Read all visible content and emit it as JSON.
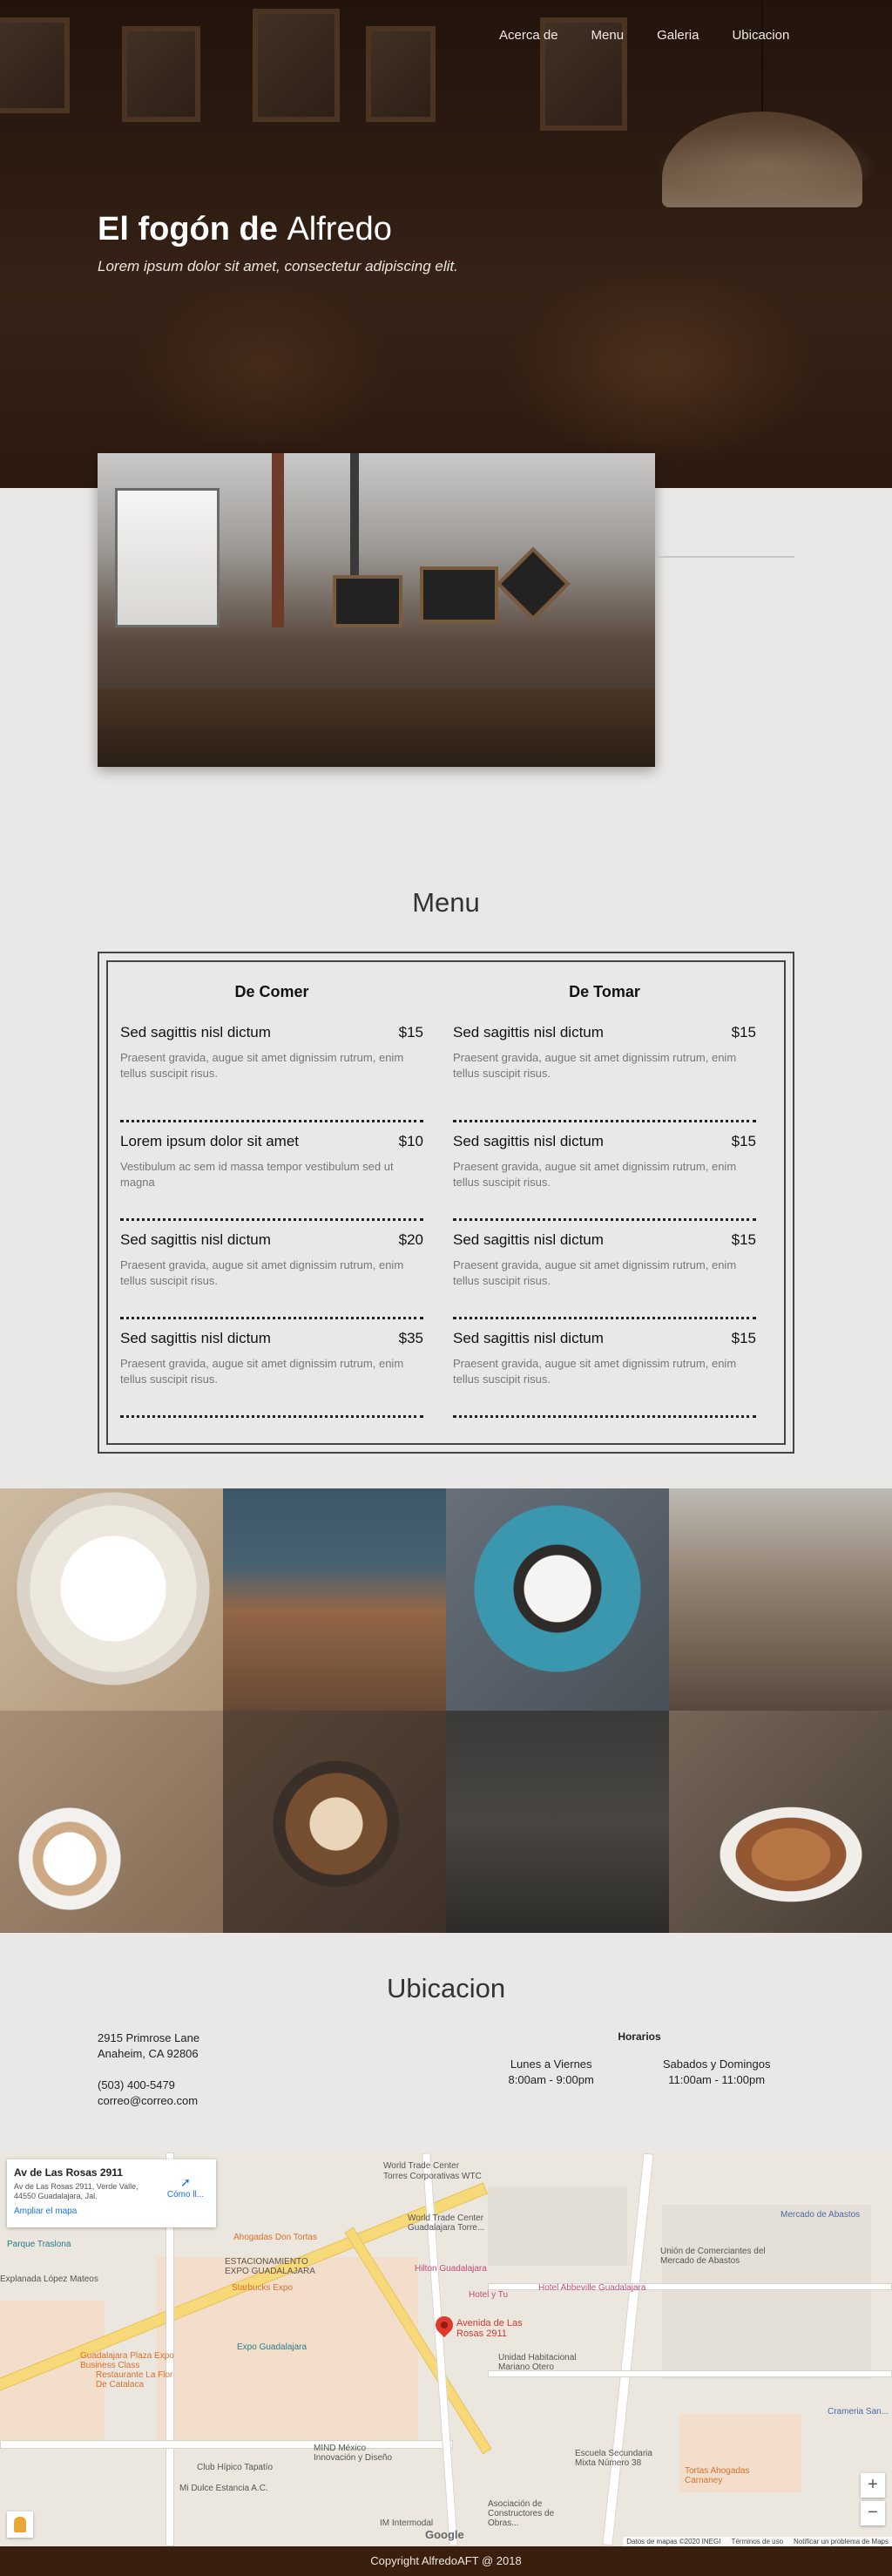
{
  "nav": {
    "items": [
      "Acerca de",
      "Menu",
      "Galeria",
      "Ubicacion"
    ]
  },
  "hero": {
    "title_bold": "El fogón de",
    "title_light": "Alfredo",
    "subtitle": "Lorem ipsum dolor sit amet, consectetur adipiscing elit."
  },
  "menu": {
    "title": "Menu",
    "columns": [
      {
        "heading": "De Comer",
        "items": [
          {
            "name": "Sed sagittis nisl dictum",
            "price": "$15",
            "desc": "Praesent gravida, augue sit amet dignissim rutrum, enim tellus suscipit risus."
          },
          {
            "name": "Lorem ipsum dolor sit amet",
            "price": "$10",
            "desc": "Vestibulum ac sem id massa tempor vestibulum sed ut magna"
          },
          {
            "name": "Sed sagittis nisl dictum",
            "price": "$20",
            "desc": "Praesent gravida, augue sit amet dignissim rutrum, enim tellus suscipit risus."
          },
          {
            "name": "Sed sagittis nisl dictum",
            "price": "$35",
            "desc": "Praesent gravida, augue sit amet dignissim rutrum, enim tellus suscipit risus."
          }
        ]
      },
      {
        "heading": "De Tomar",
        "items": [
          {
            "name": "Sed sagittis nisl dictum",
            "price": "$15",
            "desc": "Praesent gravida, augue sit amet dignissim rutrum, enim tellus suscipit risus."
          },
          {
            "name": "Sed sagittis nisl dictum",
            "price": "$15",
            "desc": "Praesent gravida, augue sit amet dignissim rutrum, enim tellus suscipit risus."
          },
          {
            "name": "Sed sagittis nisl dictum",
            "price": "$15",
            "desc": "Praesent gravida, augue sit amet dignissim rutrum, enim tellus suscipit risus."
          },
          {
            "name": "Sed sagittis nisl dictum",
            "price": "$15",
            "desc": "Praesent gravida, augue sit amet dignissim rutrum, enim tellus suscipit risus."
          }
        ]
      }
    ]
  },
  "location": {
    "title": "Ubicacion",
    "address_line1": "2915 Primrose Lane",
    "address_line2": "Anaheim, CA 92806",
    "phone": "(503) 400-5479",
    "email": "correo@correo.com",
    "hours_title": "Horarios",
    "hours": [
      {
        "days": "Lunes a Viernes",
        "time": "8:00am - 9:00pm"
      },
      {
        "days": "Sabados y Domingos",
        "time": "11:00am - 11:00pm"
      }
    ]
  },
  "map": {
    "card_title": "Av de Las Rosas 2911",
    "card_address": "Av de Las Rosas 2911, Verde Valle, 44550 Guadalajara, Jal.",
    "card_link": "Ampliar el mapa",
    "card_directions": "Cómo ll...",
    "pin_label_1": "Avenida de Las",
    "pin_label_2": "Rosas 2911",
    "labels": [
      "World Trade Center",
      "Torres Corporativas WTC",
      "World Trade Center Guadalajara Torre...",
      "Parque Traslona",
      "Explanada López Mateos",
      "Ahogadas Don Tortas",
      "ESTACIONAMIENTO EXPO GUADALAJARA",
      "Starbucks Expo",
      "Hilton Guadalajara",
      "Hotel y Tu",
      "Hotel Abbeville Guadalajara",
      "Expo Guadalajara",
      "Unidad Habitacional Mariano Otero",
      "Unión de Comerciantes del Mercado de Abastos",
      "Mercado de Abastos",
      "Guadalajara Plaza Expo Business Class",
      "Restaurante La Flor De Catalaca",
      "MIND México Innovación y Diseño",
      "Club Hípico Tapatío",
      "Mi Dulce Estancia A.C.",
      "Escuela Secundaria Mixta Número 38",
      "Tortas Ahogadas Carnaney",
      "Crameria San...",
      "IM Intermodal",
      "Asociación de Constructores de Obras..."
    ],
    "zoom_in": "+",
    "zoom_out": "−",
    "google": "Google",
    "footer": [
      "Datos de mapas ©2020 INEGI",
      "Términos de uso",
      "Notificar un problema de Maps"
    ]
  },
  "footer": {
    "text": "Copyright AlfredoAFT @ 2018"
  }
}
